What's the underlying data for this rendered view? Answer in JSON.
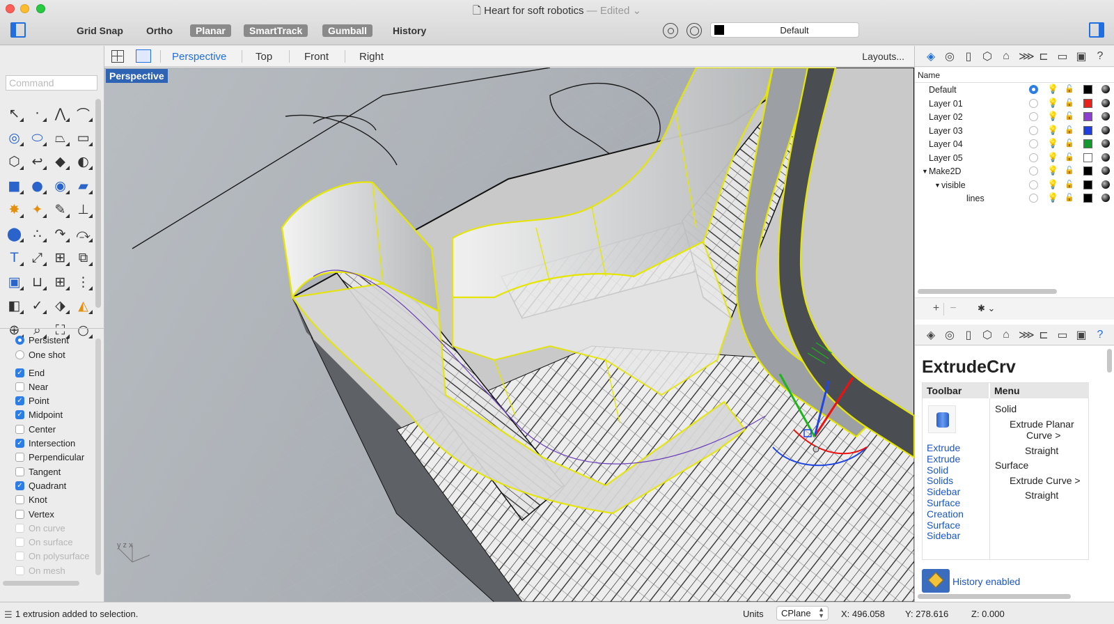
{
  "window": {
    "title": "Heart for soft robotics",
    "edited": "— Edited ⌄"
  },
  "modes": [
    {
      "label": "Grid Snap",
      "active": false
    },
    {
      "label": "Ortho",
      "active": false
    },
    {
      "label": "Planar",
      "active": true
    },
    {
      "label": "SmartTrack",
      "active": true
    },
    {
      "label": "Gumball",
      "active": true
    },
    {
      "label": "History",
      "active": false
    }
  ],
  "current_layer": {
    "label": "Default",
    "color": "#000000"
  },
  "viewport_tabs": [
    "Perspective",
    "Top",
    "Front",
    "Right"
  ],
  "active_viewport": "Perspective",
  "layouts_label": "Layouts...",
  "command": {
    "placeholder": "Command"
  },
  "tools": [
    {
      "icon": "↖",
      "name": "select-tool-icon"
    },
    {
      "icon": "·",
      "name": "point-tool-icon"
    },
    {
      "icon": "⋀",
      "name": "polyline-tool-icon"
    },
    {
      "icon": "⌒",
      "name": "curve-tool-icon"
    },
    {
      "icon": "◎",
      "name": "circle-tool-icon"
    },
    {
      "icon": "⬭",
      "name": "ellipse-tool-icon"
    },
    {
      "icon": "⏢",
      "name": "polygon-tool-icon"
    },
    {
      "icon": "▭",
      "name": "rectangle-tool-icon"
    },
    {
      "icon": "⬡",
      "name": "curve-from-object-tool-icon"
    },
    {
      "icon": "↩",
      "name": "fillet-curve-tool-icon"
    },
    {
      "icon": "◆",
      "name": "surface-tool-icon"
    },
    {
      "icon": "◐",
      "name": "surface-edit-tool-icon"
    },
    {
      "icon": "■",
      "name": "solid-box-tool-icon"
    },
    {
      "icon": "●",
      "name": "solid-boolean-tool-icon"
    },
    {
      "icon": "◉",
      "name": "cylinder-tool-icon"
    },
    {
      "icon": "▰",
      "name": "extrude-tool-icon"
    },
    {
      "icon": "✸",
      "name": "mesh-tool-icon"
    },
    {
      "icon": "✦",
      "name": "render-tool-icon"
    },
    {
      "icon": "✎",
      "name": "trim-tool-icon"
    },
    {
      "icon": "⊥",
      "name": "split-tool-icon"
    },
    {
      "icon": "⬤",
      "name": "group-tool-icon"
    },
    {
      "icon": "∴",
      "name": "points-tool-icon"
    },
    {
      "icon": "↷",
      "name": "rotate-tool-icon"
    },
    {
      "icon": "⤼",
      "name": "bend-tool-icon"
    },
    {
      "icon": "T",
      "name": "text-tool-icon"
    },
    {
      "icon": "⤢",
      "name": "scale-tool-icon"
    },
    {
      "icon": "⊞",
      "name": "align-tool-icon"
    },
    {
      "icon": "⧉",
      "name": "flow-tool-icon"
    },
    {
      "icon": "▣",
      "name": "block-tool-icon"
    },
    {
      "icon": "⊔",
      "name": "dimension-tool-icon"
    },
    {
      "icon": "⊞",
      "name": "array-tool-icon"
    },
    {
      "icon": "⋮",
      "name": "distribute-tool-icon"
    },
    {
      "icon": "◧",
      "name": "analyze-tool-icon"
    },
    {
      "icon": "✓",
      "name": "check-tool-icon"
    },
    {
      "icon": "⬗",
      "name": "shade-tool-icon"
    },
    {
      "icon": "◭",
      "name": "material-tool-icon"
    },
    {
      "icon": "⊕",
      "name": "zoom-extents-tool-icon"
    },
    {
      "icon": "⌕",
      "name": "zoom-window-tool-icon"
    },
    {
      "icon": "⛶",
      "name": "zoom-selected-tool-icon"
    },
    {
      "icon": "○",
      "name": "zoom-tool-icon"
    }
  ],
  "osnap_mode": [
    {
      "label": "Persistent",
      "selected": true
    },
    {
      "label": "One shot",
      "selected": false
    }
  ],
  "osnaps": [
    {
      "label": "End",
      "checked": true,
      "enabled": true
    },
    {
      "label": "Near",
      "checked": false,
      "enabled": true
    },
    {
      "label": "Point",
      "checked": true,
      "enabled": true
    },
    {
      "label": "Midpoint",
      "checked": true,
      "enabled": true
    },
    {
      "label": "Center",
      "checked": false,
      "enabled": true
    },
    {
      "label": "Intersection",
      "checked": true,
      "enabled": true
    },
    {
      "label": "Perpendicular",
      "checked": false,
      "enabled": true
    },
    {
      "label": "Tangent",
      "checked": false,
      "enabled": true
    },
    {
      "label": "Quadrant",
      "checked": true,
      "enabled": true
    },
    {
      "label": "Knot",
      "checked": false,
      "enabled": true
    },
    {
      "label": "Vertex",
      "checked": false,
      "enabled": true
    },
    {
      "label": "On curve",
      "checked": false,
      "enabled": false
    },
    {
      "label": "On surface",
      "checked": false,
      "enabled": false
    },
    {
      "label": "On polysurface",
      "checked": false,
      "enabled": false
    },
    {
      "label": "On mesh",
      "checked": false,
      "enabled": false
    }
  ],
  "layers": {
    "header": "Name",
    "rows": [
      {
        "name": "Default",
        "depth": 0,
        "current": true,
        "color": "#000000"
      },
      {
        "name": "Layer 01",
        "depth": 0,
        "current": false,
        "color": "#e8231c"
      },
      {
        "name": "Layer 02",
        "depth": 0,
        "current": false,
        "color": "#8e3fd1"
      },
      {
        "name": "Layer 03",
        "depth": 0,
        "current": false,
        "color": "#1f3fe0"
      },
      {
        "name": "Layer 04",
        "depth": 0,
        "current": false,
        "color": "#119a2b"
      },
      {
        "name": "Layer 05",
        "depth": 0,
        "current": false,
        "color": "#ffffff"
      },
      {
        "name": "Make2D",
        "depth": 0,
        "current": false,
        "color": "#000000",
        "expanded": true
      },
      {
        "name": "visible",
        "depth": 1,
        "current": false,
        "color": "#000000",
        "expanded": true
      },
      {
        "name": "lines",
        "depth": 2,
        "current": false,
        "color": "#000000"
      }
    ],
    "add_label": "+",
    "remove_label": "−",
    "gear_label": "✱ ⌄"
  },
  "help": {
    "command": "ExtrudeCrv",
    "toolbar_header": "Toolbar",
    "menu_header": "Menu",
    "toolbar_links": [
      "Extrude",
      "Extrude",
      "Solid",
      "Solids",
      "Sidebar",
      "Surface",
      "Creation",
      "Surface",
      "Sidebar"
    ],
    "menu_items": [
      {
        "text": "Solid",
        "indent": 0
      },
      {
        "text": "Extrude Planar",
        "indent": 1
      },
      {
        "text": "Curve >",
        "indent": 2
      },
      {
        "text": "Straight",
        "indent": 3
      },
      {
        "text": "Surface",
        "indent": 0
      },
      {
        "text": "Extrude Curve >",
        "indent": 1
      },
      {
        "text": "Straight",
        "indent": 3
      }
    ],
    "history": "History enabled"
  },
  "status": {
    "message": "1 extrusion added to selection.",
    "units_label": "Units",
    "cplane": "CPlane",
    "x": "X: 496.058",
    "y": "Y: 278.616",
    "z": "Z: 0.000"
  },
  "axis_labels": "y  z  x"
}
